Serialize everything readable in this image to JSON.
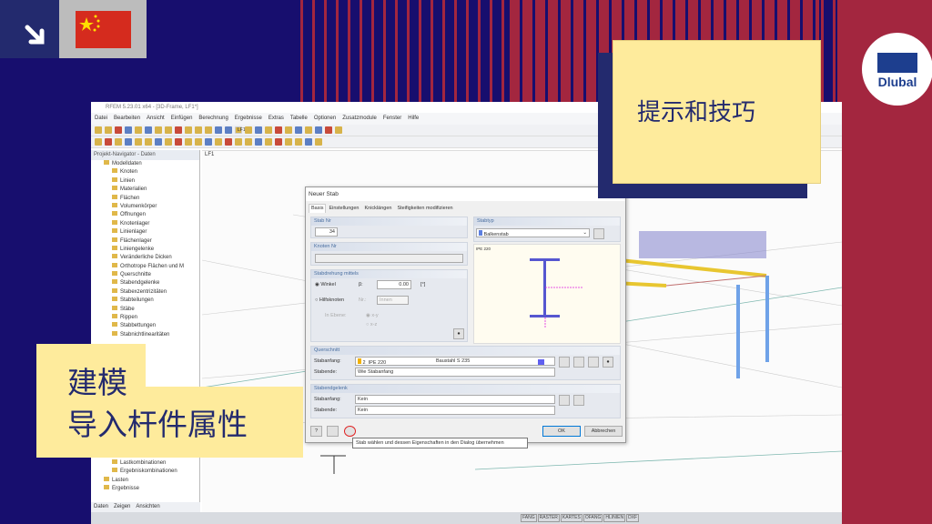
{
  "colors": {
    "navy": "#170e6e",
    "red": "#a3263f",
    "note": "#feeb9c",
    "text": "#232a6e"
  },
  "corner": {
    "arrow_icon": "arrow-down-right-icon",
    "flag_icon": "china-flag-icon"
  },
  "logo": {
    "text": "Dlubal"
  },
  "window": {
    "title": "RFEM 5.23.01 x64 - [3D-Frame, LF1*]",
    "menu": [
      "Datei",
      "Bearbeiten",
      "Ansicht",
      "Einfügen",
      "Berechnung",
      "Ergebnisse",
      "Extras",
      "Tabelle",
      "Optionen",
      "Zusatzmodule",
      "Fenster",
      "Hilfe"
    ],
    "loadcase": "LF1",
    "view_label": "LF1"
  },
  "navigator": {
    "title": "Projekt-Navigator - Daten",
    "root": "Modelldaten",
    "items": [
      "Knoten",
      "Linien",
      "Materialien",
      "Flächen",
      "Volumenkörper",
      "Öffnungen",
      "Knotenlager",
      "Linienlager",
      "Flächenlager",
      "Liniengelenke",
      "Veränderliche Dicken",
      "Orthotrope Flächen und M",
      "Querschnitte",
      "Stabendgelenke",
      "Stabexzentrizitäten",
      "Stabteilungen",
      "Stäbe",
      "Rippen",
      "Stabbettungen",
      "Stabnichtlinearitäten"
    ],
    "lower_items": [
      "Lastkombinationen",
      "Ergebniskombinationen"
    ],
    "bottom_items": [
      "Lasten",
      "Ergebnisse"
    ],
    "tabs": [
      "Daten",
      "Zeigen",
      "Ansichten"
    ]
  },
  "status": [
    "FANG",
    "RASTER",
    "KARTES",
    "OFANG",
    "HLINIEN",
    "DXF"
  ],
  "dialog": {
    "title": "Neuer Stab",
    "tabs": [
      "Basis",
      "Einstellungen",
      "Knicklängen",
      "Steifigkeiten modifizieren"
    ],
    "stab_nr_label": "Stab Nr",
    "stab_nr": "34",
    "knoten_label": "Knoten Nr",
    "stabtyp_label": "Stabtyp",
    "stabtyp": "Balkenstab",
    "drehung_label": "Stabdrehung mittels",
    "winkel": "Winkel",
    "beta": "β:",
    "beta_value": "0.00",
    "unit": "[°]",
    "hilfsknoten": "Hilfsknoten",
    "nr": "Nr.:",
    "innen": "Innen",
    "ebene": "In Ebene:",
    "xy": "x-y",
    "xz": "x-z",
    "preview_label": "IPE 220",
    "querschnitt_label": "Querschnitt",
    "stabanfang": "Stabanfang:",
    "stabende": "Stabende:",
    "qs_nr": "2",
    "qs_name": "IPE 220",
    "material": "Baustahl S 235",
    "wie": "Wie Stabanfang",
    "gelenk_label": "Stabendgelenk",
    "kein": "Kein",
    "ok": "OK",
    "cancel": "Abbrechen",
    "tooltip": "Stab wählen und dessen Eigenschaften in den Dialog übernehmen"
  },
  "note_top": "提示和技巧",
  "note_bottom": {
    "line1": "建模",
    "line2": "导入杆件属性"
  }
}
